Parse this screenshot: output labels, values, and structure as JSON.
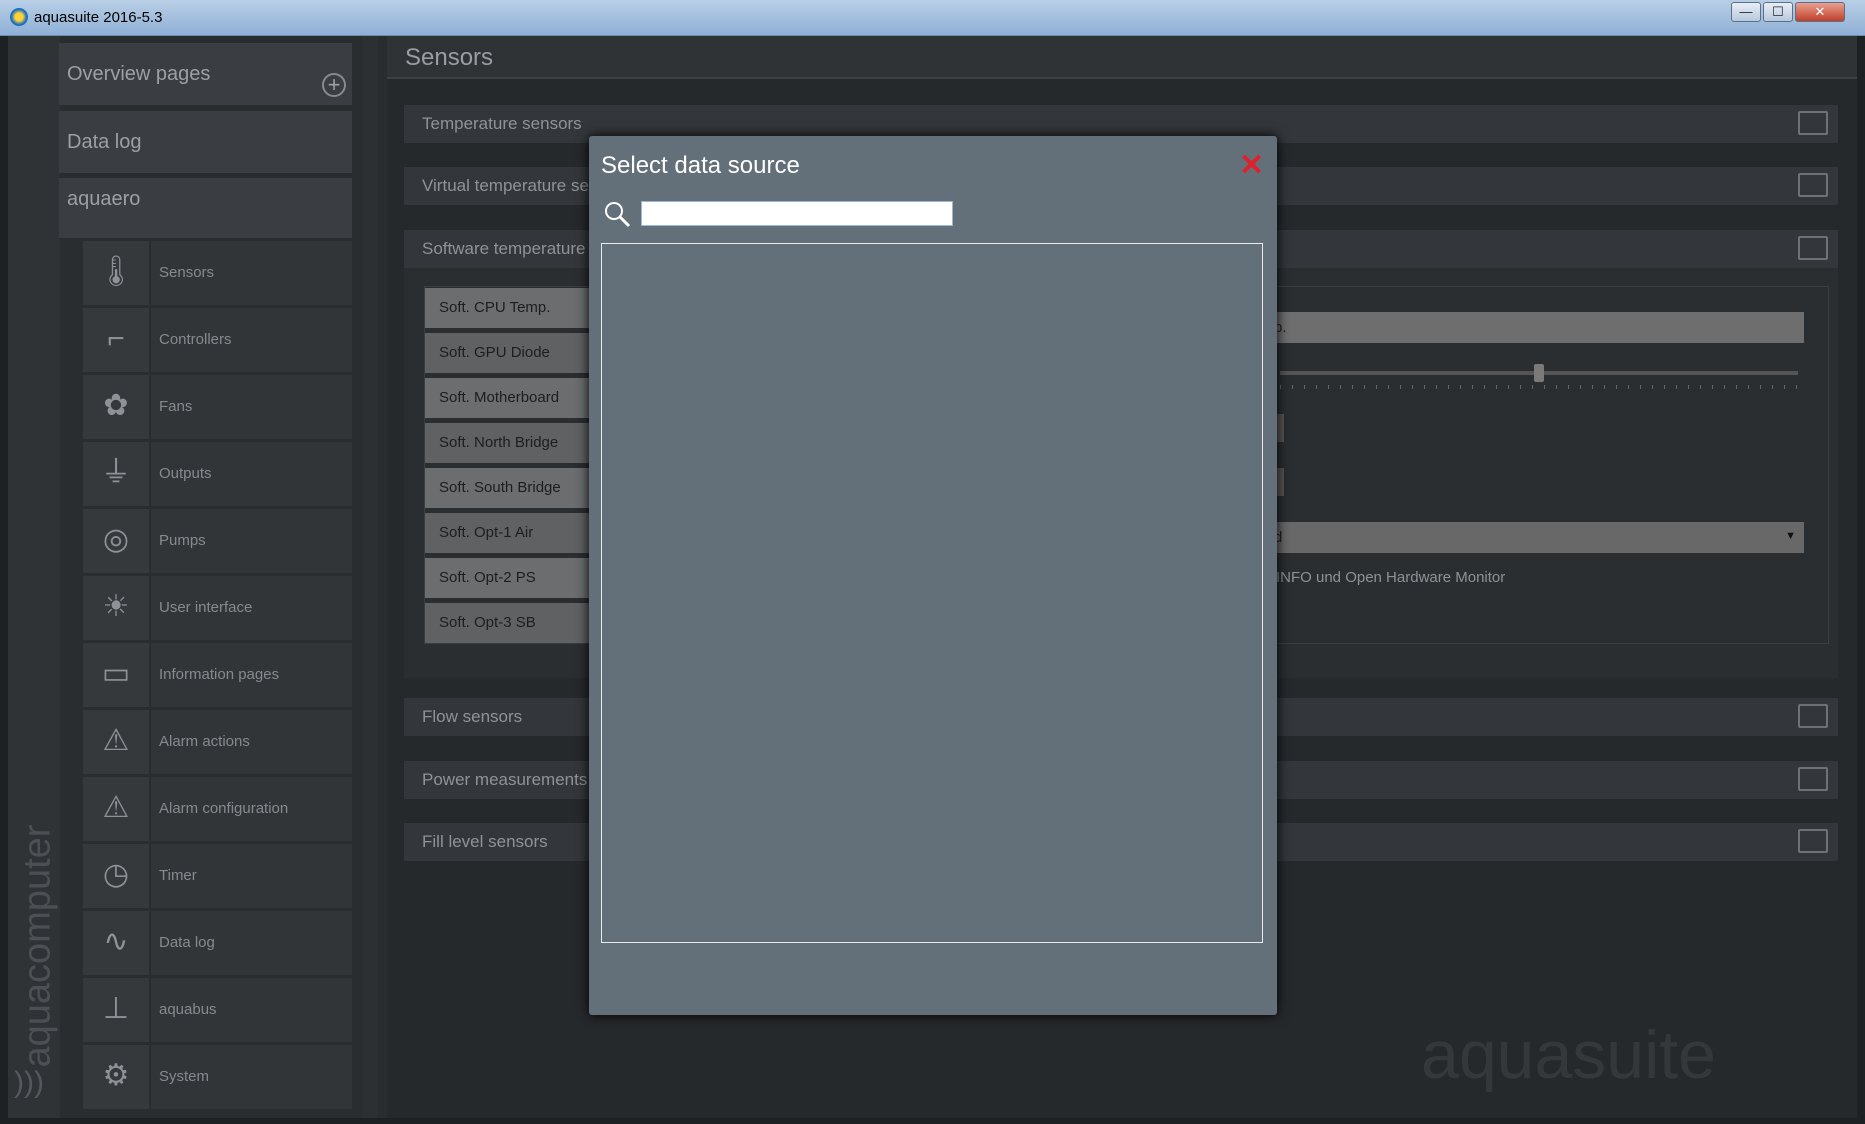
{
  "window": {
    "title": "aquasuite 2016-5.3",
    "minimize": "—",
    "maximize": "☐",
    "close": "✕"
  },
  "sidebar": {
    "brand": "aquacomputer",
    "overview": "Overview pages",
    "add": "+",
    "datalog": "Data log",
    "device": "aquaero",
    "items": [
      {
        "label": "Sensors",
        "icon": "🌡"
      },
      {
        "label": "Controllers",
        "icon": "⌐"
      },
      {
        "label": "Fans",
        "icon": "✿"
      },
      {
        "label": "Outputs",
        "icon": "⏚"
      },
      {
        "label": "Pumps",
        "icon": "◎"
      },
      {
        "label": "User interface",
        "icon": "☀"
      },
      {
        "label": "Information pages",
        "icon": "▭"
      },
      {
        "label": "Alarm actions",
        "icon": "⚠"
      },
      {
        "label": "Alarm configuration",
        "icon": "⚠"
      },
      {
        "label": "Timer",
        "icon": "◷"
      },
      {
        "label": "Data log",
        "icon": "∿"
      },
      {
        "label": "aquabus",
        "icon": "⊥"
      },
      {
        "label": "System",
        "icon": "⚙"
      }
    ]
  },
  "main": {
    "title": "Sensors",
    "sections": [
      "Temperature sensors",
      "Virtual temperature sensors",
      "Software temperature sensors",
      "Flow sensors",
      "Power measurements",
      "Fill level sensors"
    ],
    "software_items": [
      "Soft. CPU Temp.",
      "Soft. GPU Diode",
      "Soft. Motherboard",
      "Soft. North Bridge",
      "Soft. South Bridge",
      "Soft. Opt-1 Air",
      "Soft. Opt-2 PS",
      "Soft. Opt-3 SB"
    ],
    "name_field_fragment": "p.",
    "slider_fraction": 0.5,
    "dropdown_fragment": "d",
    "source_note_fragment": "INFO und Open Hardware Monitor",
    "watermark": "aquasuite"
  },
  "dialog": {
    "title": "Select data source",
    "close": "✕",
    "search_value": "",
    "close_color": "#e0202a"
  }
}
